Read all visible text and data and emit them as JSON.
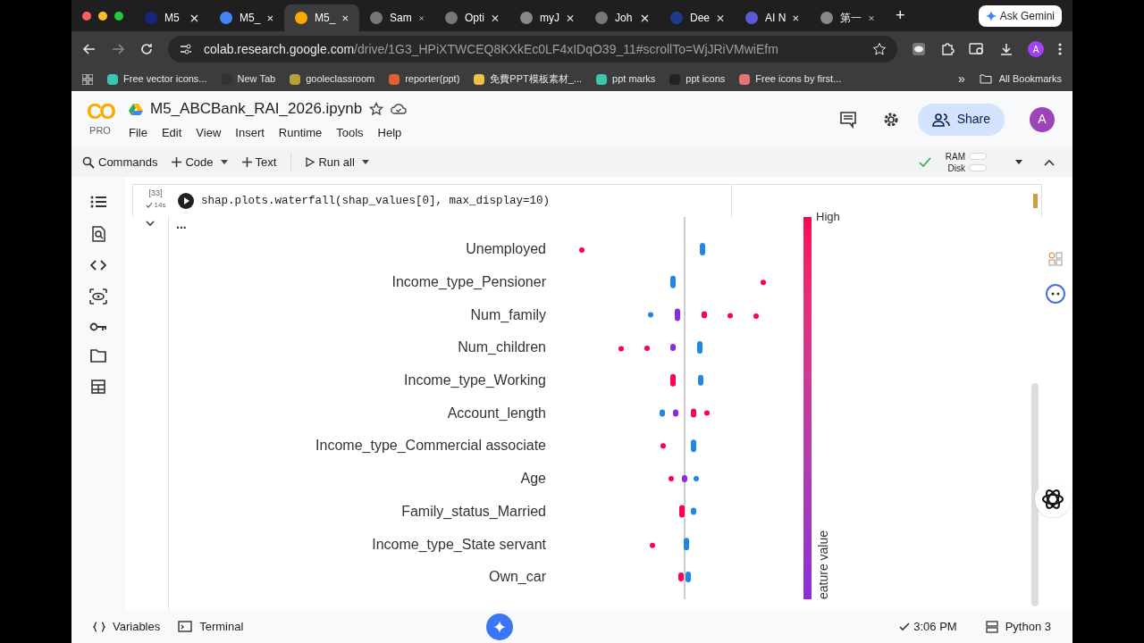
{
  "browser": {
    "tabs": [
      {
        "label": "M5",
        "selected": false
      },
      {
        "label": "M5_",
        "selected": false
      },
      {
        "label": "M5_",
        "selected": true
      },
      {
        "label": "Sam",
        "selected": false
      },
      {
        "label": "Opti",
        "selected": false
      },
      {
        "label": "myJ",
        "selected": false
      },
      {
        "label": "Joh",
        "selected": false
      },
      {
        "label": "Dee",
        "selected": false
      },
      {
        "label": "AI N",
        "selected": false
      },
      {
        "label": "第一",
        "selected": false
      }
    ],
    "new_tab": "+",
    "ask_gemini": "Ask Gemini",
    "url_host": "colab.research.google.com",
    "url_path": "/drive/1G3_HPiXTWCEQ8KXkEc0LF4xIDqO39_11#scrollTo=WjJRiVMwiEfm",
    "profile": "A",
    "bookmarks": [
      "Free vector icons...",
      "New Tab",
      "gooleclassroom",
      "reporter(ppt)",
      "免費PPT模板素材_...",
      "ppt marks",
      "ppt icons",
      "Free icons by first..."
    ],
    "more_bookmarks": "»",
    "all_bookmarks": "All Bookmarks"
  },
  "colab": {
    "logo": "CO",
    "plan": "PRO",
    "title": "M5_ABCBank_RAI_2026.ipynb",
    "menu": [
      "File",
      "Edit",
      "View",
      "Insert",
      "Runtime",
      "Tools",
      "Help"
    ],
    "share": "Share",
    "avatar": "A",
    "toolbar": {
      "commands": "Commands",
      "code": "Code",
      "text": "Text",
      "run_all": "Run all",
      "ram": "RAM",
      "disk": "Disk"
    },
    "cell": {
      "number": "[33]",
      "duration": "14s",
      "code": "shap.plots.waterfall(shap_values[0], max_display=10)",
      "output_menu": "..."
    },
    "plot": {
      "features": [
        "Unemployed",
        "Income_type_Pensioner",
        "Num_family",
        "Num_children",
        "Income_type_Working",
        "Account_length",
        "Income_type_Commercial associate",
        "Age",
        "Family_status_Married",
        "Income_type_State servant",
        "Own_car"
      ],
      "colorbar_top": "High",
      "colorbar_label": "eature value"
    },
    "status": {
      "variables": "Variables",
      "terminal": "Terminal",
      "time": "3:06 PM",
      "runtime": "Python 3"
    }
  }
}
